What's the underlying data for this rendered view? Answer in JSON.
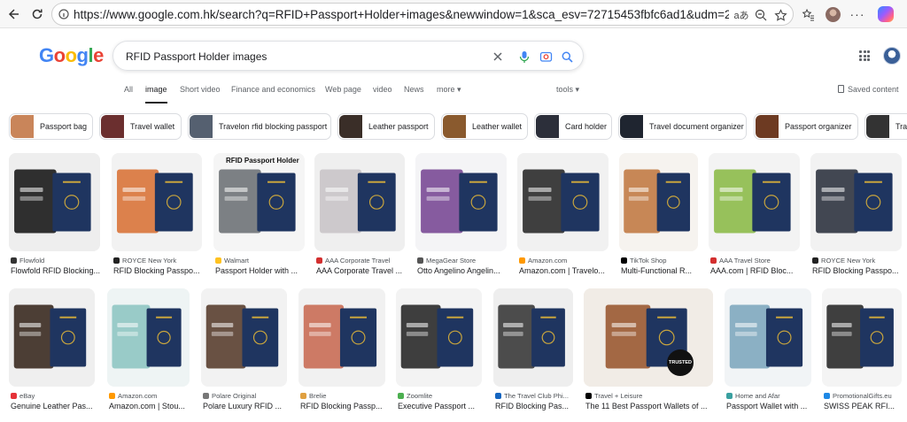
{
  "browser": {
    "url": "https://www.google.com.hk/search?q=RFID+Passport+Holder+images&newwindow=1&sca_esv=72715453fbfc6ad1&udm=2&biw=1696&bih...",
    "read_aloud_label": "aあ"
  },
  "google": {
    "logo_letters": [
      "G",
      "o",
      "o",
      "g",
      "l",
      "e"
    ],
    "logo_colors": [
      "#4285f4",
      "#ea4335",
      "#fbbc05",
      "#4285f4",
      "#34a853",
      "#ea4335"
    ],
    "query": "RFID Passport Holder images"
  },
  "tabs": [
    {
      "label": "All"
    },
    {
      "label": "image",
      "active": true
    },
    {
      "label": "Short video"
    },
    {
      "label": "Finance and economics"
    },
    {
      "label": "Web page"
    },
    {
      "label": "video"
    },
    {
      "label": "News"
    },
    {
      "label": "more ▾"
    },
    {
      "label": "tools ▾"
    }
  ],
  "saved_content": "Saved content",
  "chips": [
    {
      "label": "Passport bag",
      "color": "#c9855a"
    },
    {
      "label": "Travel wallet",
      "color": "#6b2f2f"
    },
    {
      "label": "Travelon rfid blocking passport",
      "color": "#556070"
    },
    {
      "label": "Leather passport",
      "color": "#3a2e28"
    },
    {
      "label": "Leather wallet",
      "color": "#8a5a2e"
    },
    {
      "label": "Card holder",
      "color": "#2c2f3a"
    },
    {
      "label": "Travel document organizer",
      "color": "#1f2530"
    },
    {
      "label": "Passport organizer",
      "color": "#6d3a22"
    },
    {
      "label": "Tra",
      "color": "#333333"
    }
  ],
  "row1": [
    {
      "source": "Flowfold",
      "title": "Flowfold RFID Blocking...",
      "bg": "#eeeeee",
      "fg": "#1a1a1a",
      "fav": "#333"
    },
    {
      "source": "ROYCE New York",
      "title": "RFID Blocking Passpo...",
      "bg": "#f2f2f2",
      "fg": "#d9743a",
      "fav": "#222"
    },
    {
      "source": "Walmart",
      "title": "Passport Holder with ...",
      "bg": "#f5f5f5",
      "fg": "#6f7378",
      "fav": "#ffc220",
      "overlay": "RFID Passport Holder"
    },
    {
      "source": "AAA Corporate Travel",
      "title": "AAA Corporate Travel ...",
      "bg": "#efefef",
      "fg": "#c9c4c8",
      "fav": "#d32f2f"
    },
    {
      "source": "MegaGear Store",
      "title": "Otto Angelino Angelin...",
      "bg": "#f4f4f6",
      "fg": "#7a4a96",
      "fav": "#555"
    },
    {
      "source": "Amazon.com",
      "title": "Amazon.com | Travelo...",
      "bg": "#f1f1f1",
      "fg": "#2b2b2b",
      "fav": "#ff9900"
    },
    {
      "source": "TikTok Shop",
      "title": "Multi-Functional R...",
      "bg": "#f6f3ef",
      "fg": "#c27b45",
      "fav": "#000"
    },
    {
      "source": "AAA Travel Store",
      "title": "AAA.com | RFID Bloc...",
      "bg": "#f3f3f3",
      "fg": "#8dbb4a",
      "fav": "#d32f2f"
    },
    {
      "source": "ROYCE New York",
      "title": "RFID Blocking Passpo...",
      "bg": "#f2f2f2",
      "fg": "#2f3440",
      "fav": "#222"
    }
  ],
  "row2": [
    {
      "source": "eBay",
      "title": "Genuine Leather Pas...",
      "bg": "#efefef",
      "fg": "#3a2a20",
      "fav": "#e53238"
    },
    {
      "source": "Amazon.com",
      "title": "Amazon.com | Stou...",
      "bg": "#eef4f4",
      "fg": "#8fc7c3",
      "fav": "#ff9900"
    },
    {
      "source": "Polare Original",
      "title": "Polare Luxury RFID ...",
      "bg": "#f2f2f2",
      "fg": "#5a3f30",
      "fav": "#777"
    },
    {
      "source": "Brelie",
      "title": "RFID Blocking Passp...",
      "bg": "#f1f1f1",
      "fg": "#c96d55",
      "fav": "#e0a040"
    },
    {
      "source": "Zoomlite",
      "title": "Executive Passport ...",
      "bg": "#f3f3f3",
      "fg": "#2a2a2a",
      "fav": "#4caf50"
    },
    {
      "source": "The Travel Club Phi...",
      "title": "RFID Blocking Pas...",
      "bg": "#eeeeee",
      "fg": "#3a3a3a",
      "fav": "#1565c0"
    },
    {
      "source": "Travel + Leisure",
      "title": "The 11 Best Passport Wallets of ...",
      "bg": "#f1ece6",
      "fg": "#9a5a32",
      "fav": "#000",
      "overlay": "TRUSTED"
    },
    {
      "source": "Home and Afar",
      "title": "Passport Wallet with ...",
      "bg": "#f1f4f6",
      "fg": "#7fa9bf",
      "fav": "#3aa0a0"
    },
    {
      "source": "PromotionalGifts.eu",
      "title": "SWISS PEAK RFI...",
      "bg": "#f4f4f4",
      "fg": "#2b2b2b",
      "fav": "#1e88e5"
    }
  ]
}
